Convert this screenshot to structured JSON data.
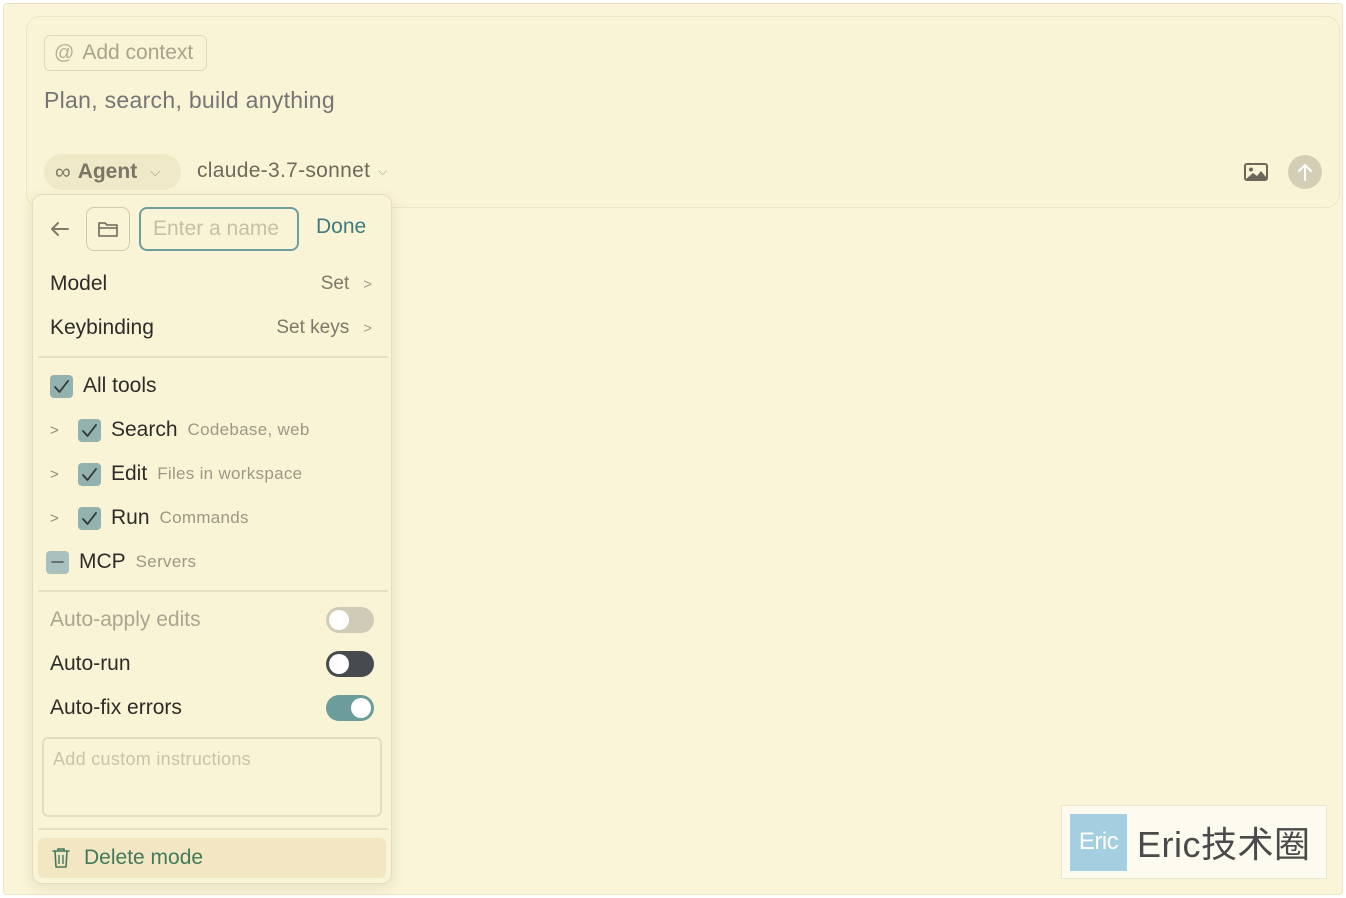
{
  "composer": {
    "context_chip_label": "Add context",
    "prompt_placeholder": "Plan, search, build anything",
    "mode_label": "Agent",
    "model_label": "claude-3.7-sonnet"
  },
  "mode_editor": {
    "name_placeholder": "Enter a name",
    "done_label": "Done",
    "model_row": {
      "label": "Model",
      "value": "Set"
    },
    "keybinding_row": {
      "label": "Keybinding",
      "value": "Set keys"
    },
    "all_tools": {
      "label": "All tools",
      "checked": true
    },
    "tools": [
      {
        "label": "Search",
        "description": "Codebase, web",
        "checked": true
      },
      {
        "label": "Edit",
        "description": "Files in workspace",
        "checked": true
      },
      {
        "label": "Run",
        "description": "Commands",
        "checked": true
      }
    ],
    "mcp": {
      "label": "MCP",
      "description": "Servers",
      "state": "partial"
    },
    "toggles": [
      {
        "label": "Auto-apply edits",
        "on": false,
        "disabled": true
      },
      {
        "label": "Auto-run",
        "on": false,
        "disabled": false
      },
      {
        "label": "Auto-fix errors",
        "on": true,
        "disabled": false
      }
    ],
    "instructions_placeholder": "Add custom instructions",
    "delete_label": "Delete mode"
  },
  "watermark": {
    "logo_text": "Eric",
    "text": "Eric技术圈"
  },
  "colors": {
    "background": "#faf5d8",
    "accent": "#3e7a7e",
    "checkbox": "#93b2ad",
    "toggle_on": "#6c9c9b",
    "toggle_dark": "#474a4f",
    "delete_text": "#437a5b"
  }
}
